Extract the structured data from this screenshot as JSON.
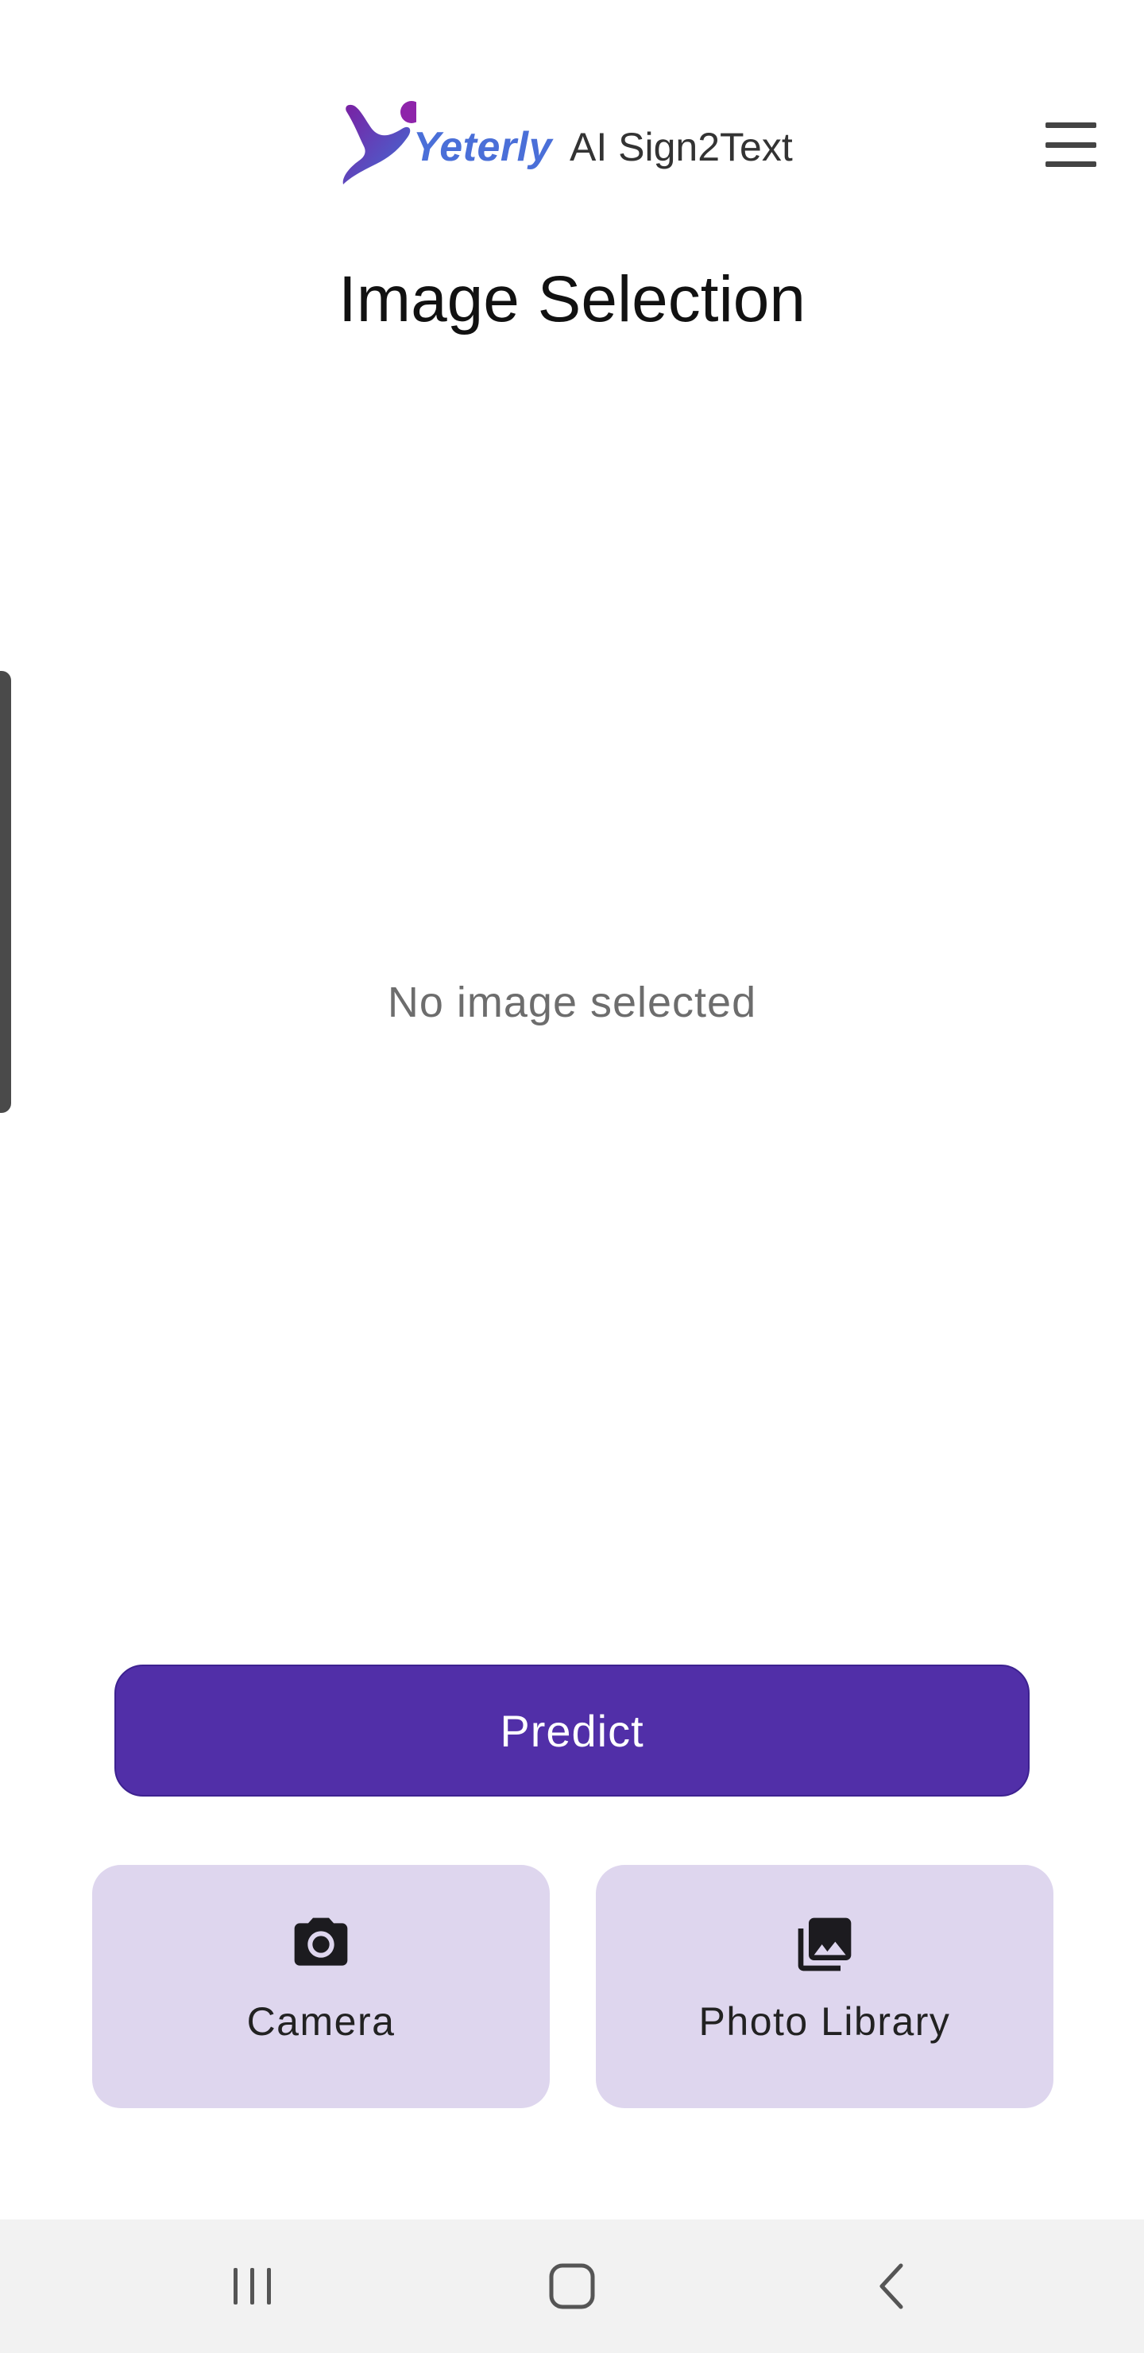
{
  "header": {
    "logo_brand": "Yeterly",
    "logo_product": "AI Sign2Text",
    "menu_icon": "hamburger-menu-icon"
  },
  "page": {
    "title": "Image Selection",
    "empty_state": "No image selected"
  },
  "actions": {
    "predict_label": "Predict",
    "camera_label": "Camera",
    "camera_icon": "camera-icon",
    "library_label": "Photo Library",
    "library_icon": "photo-library-icon"
  },
  "nav_bar": {
    "recents_icon": "recents-icon",
    "home_icon": "home-icon",
    "back_icon": "back-icon"
  },
  "colors": {
    "primary": "#512fa8",
    "card_background": "#ded6ee",
    "brand_blue": "#4a6fd8",
    "brand_purple": "#7b1fa2",
    "nav_background": "#f2f2f2"
  }
}
